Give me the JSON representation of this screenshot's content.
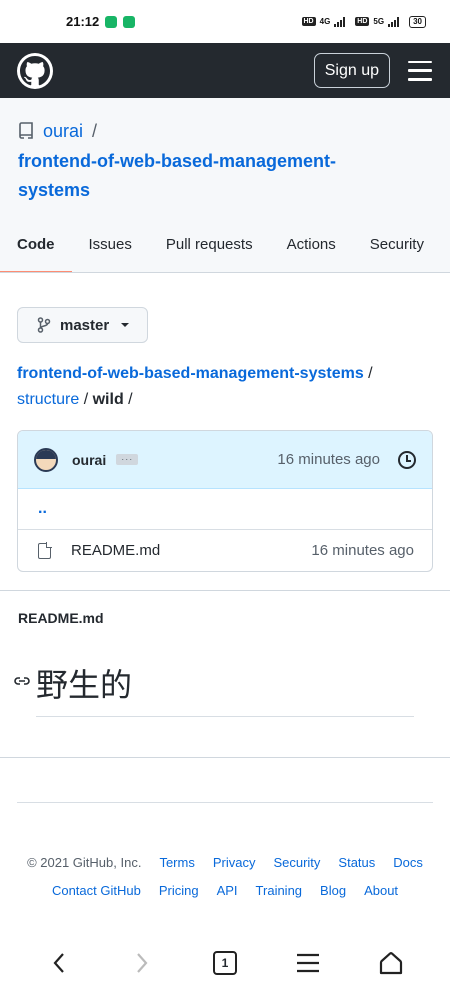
{
  "statusbar": {
    "time": "21:12",
    "battery": "30",
    "hd_label": "HD",
    "net1": "4G",
    "net2": "5G"
  },
  "header": {
    "signup_label": "Sign up"
  },
  "repo": {
    "owner": "ourai",
    "separator": "/",
    "name": "frontend-of-web-based-management-systems"
  },
  "tabs": [
    {
      "label": "Code",
      "active": true
    },
    {
      "label": "Issues"
    },
    {
      "label": "Pull requests"
    },
    {
      "label": "Actions"
    },
    {
      "label": "Security"
    }
  ],
  "branch": {
    "label": "master"
  },
  "breadcrumb": {
    "root": "frontend-of-web-based-management-systems",
    "dir1": "structure",
    "current": "wild",
    "sep": "/"
  },
  "commit": {
    "author": "ourai",
    "ellipsis": "···",
    "time": "16 minutes ago"
  },
  "files": {
    "parent": "..",
    "items": [
      {
        "name": "README.md",
        "time": "16 minutes ago"
      }
    ]
  },
  "readme": {
    "title": "README.md",
    "heading": "野生的"
  },
  "footer": {
    "copyright": "© 2021 GitHub, Inc.",
    "links_row1": [
      "Terms",
      "Privacy",
      "Security",
      "Status",
      "Docs"
    ],
    "links_row2": [
      "Contact GitHub",
      "Pricing",
      "API",
      "Training",
      "Blog",
      "About"
    ]
  },
  "navbar": {
    "tabs_count": "1"
  }
}
